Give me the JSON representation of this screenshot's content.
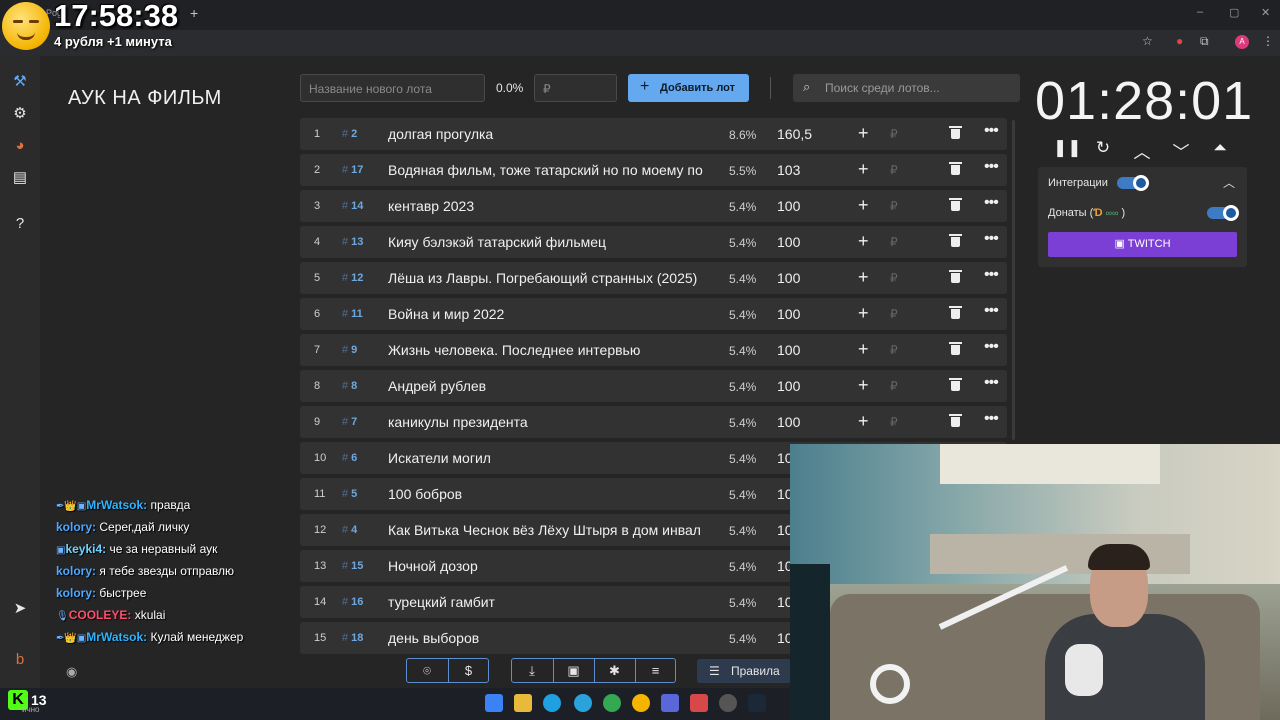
{
  "browser": {
    "tab_title": "Pog",
    "tab_plus": "+",
    "profile_letter": "A",
    "window_controls": [
      "–",
      "▢",
      "✕"
    ]
  },
  "overlay": {
    "time": "17:58:38",
    "price_line": "4 рубля +1 минута"
  },
  "app": {
    "title": "АУК НА ФИЛЬМ",
    "new_lot_placeholder": "Название нового лота",
    "total_percent": "0.0%",
    "amount_placeholder": "₽",
    "add_button": "Добавить лот",
    "search_placeholder": "Поиск среди лотов...",
    "rules_button": "Правила"
  },
  "lots": [
    {
      "num": "1",
      "id": "2",
      "name": "долгая прогулка",
      "pct": "8.6%",
      "amount": "160,5"
    },
    {
      "num": "2",
      "id": "17",
      "name": "Водяная фильм, тоже татарский но по моему по",
      "pct": "5.5%",
      "amount": "103"
    },
    {
      "num": "3",
      "id": "14",
      "name": "кентавр 2023",
      "pct": "5.4%",
      "amount": "100"
    },
    {
      "num": "4",
      "id": "13",
      "name": "Кияу бэлэкэй татарский фильмец",
      "pct": "5.4%",
      "amount": "100"
    },
    {
      "num": "5",
      "id": "12",
      "name": "Лёша из Лавры. Погребающий странных (2025)",
      "pct": "5.4%",
      "amount": "100"
    },
    {
      "num": "6",
      "id": "11",
      "name": "Война и мир 2022",
      "pct": "5.4%",
      "amount": "100"
    },
    {
      "num": "7",
      "id": "9",
      "name": "Жизнь человека. Последнее интервью",
      "pct": "5.4%",
      "amount": "100"
    },
    {
      "num": "8",
      "id": "8",
      "name": "Андрей рублев",
      "pct": "5.4%",
      "amount": "100"
    },
    {
      "num": "9",
      "id": "7",
      "name": "каникулы президента",
      "pct": "5.4%",
      "amount": "100"
    },
    {
      "num": "10",
      "id": "6",
      "name": "Искатели могил",
      "pct": "5.4%",
      "amount": "10"
    },
    {
      "num": "11",
      "id": "5",
      "name": "100 бобров",
      "pct": "5.4%",
      "amount": "10"
    },
    {
      "num": "12",
      "id": "4",
      "name": "Как Витька Чеснок вёз Лёху Штыря в дом инвал",
      "pct": "5.4%",
      "amount": "10"
    },
    {
      "num": "13",
      "id": "15",
      "name": "Ночной дозор",
      "pct": "5.4%",
      "amount": "10"
    },
    {
      "num": "14",
      "id": "16",
      "name": "турецкий гамбит",
      "pct": "5.4%",
      "amount": "10"
    },
    {
      "num": "15",
      "id": "18",
      "name": "день выборов",
      "pct": "5.4%",
      "amount": "10"
    }
  ],
  "timer": {
    "value": "01:28:01"
  },
  "integrations": {
    "label": "Интеграции",
    "donations_label": "Донаты (",
    "donations_close": ")",
    "twitch_button": "TWITCH"
  },
  "chat": [
    {
      "user": "MrWatsok:",
      "text": "правда",
      "color": "#2fb3ff",
      "badges": "✒👑▣"
    },
    {
      "user": "kolory:",
      "text": "Серег,дай личку",
      "color": "#4ea8ff",
      "badges": ""
    },
    {
      "user": "keyki4:",
      "text": "че за неравный аук",
      "color": "#6fd3ff",
      "badges": "▣"
    },
    {
      "user": "kolory:",
      "text": "я тебе звезды отправлю",
      "color": "#4ea8ff",
      "badges": ""
    },
    {
      "user": "kolory:",
      "text": "быстрее",
      "color": "#4ea8ff",
      "badges": ""
    },
    {
      "user": "COOLEYE:",
      "text": "xkulai",
      "color": "#ff4d6d",
      "badges": "🎙"
    },
    {
      "user": "MrWatsok:",
      "text": "Кулай менеджер",
      "color": "#2fb3ff",
      "badges": "✒👑▣"
    }
  ],
  "kick": {
    "logo": "K",
    "count": "13",
    "sub": "ично"
  },
  "colors": {
    "accent": "#64a8f0",
    "twitch": "#7b3fd6",
    "lot_id": "#6fa8dc"
  }
}
